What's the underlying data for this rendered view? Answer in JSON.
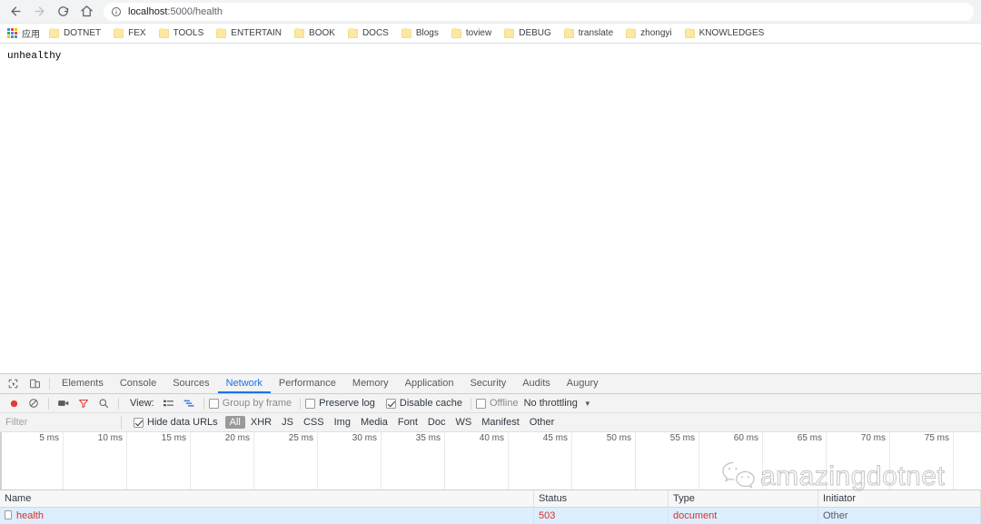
{
  "browser": {
    "nav": {
      "back_title": "Back",
      "forward_title": "Forward",
      "reload_title": "Reload",
      "home_title": "Home"
    },
    "omnibox": {
      "info_icon": "info-circle-icon",
      "url_host": "localhost",
      "url_rest": ":5000/health",
      "full_url": "localhost:5000/health"
    },
    "bookmarks": {
      "apps_label": "应用",
      "apps_icon": "apps-grid-icon",
      "items": [
        {
          "label": "DOTNET"
        },
        {
          "label": "FEX"
        },
        {
          "label": "TOOLS"
        },
        {
          "label": "ENTERTAIN"
        },
        {
          "label": "BOOK"
        },
        {
          "label": "DOCS"
        },
        {
          "label": "Blogs"
        },
        {
          "label": "toview"
        },
        {
          "label": "DEBUG"
        },
        {
          "label": "translate"
        },
        {
          "label": "zhongyi"
        },
        {
          "label": "KNOWLEDGES"
        }
      ]
    }
  },
  "page": {
    "body_text": "unhealthy"
  },
  "devtools": {
    "left_icons": [
      {
        "name": "inspect-element-icon"
      },
      {
        "name": "device-toolbar-icon"
      }
    ],
    "tabs": [
      {
        "label": "Elements",
        "active": false
      },
      {
        "label": "Console",
        "active": false
      },
      {
        "label": "Sources",
        "active": false
      },
      {
        "label": "Network",
        "active": true
      },
      {
        "label": "Performance",
        "active": false
      },
      {
        "label": "Memory",
        "active": false
      },
      {
        "label": "Application",
        "active": false
      },
      {
        "label": "Security",
        "active": false
      },
      {
        "label": "Audits",
        "active": false
      },
      {
        "label": "Augury",
        "active": false
      }
    ],
    "toolbar": {
      "record_icon": "record-circle-icon",
      "clear_icon": "clear-no-entry-icon",
      "capture_screenshots_icon": "camera-film-icon",
      "filter_icon": "funnel-filter-icon",
      "search_icon": "search-magnifier-icon",
      "view_label": "View:",
      "view_list_icon": "list-view-icon",
      "view_waterfall_icon": "waterfall-view-icon",
      "group_by_frame": {
        "label": "Group by frame",
        "checked": false,
        "disabled": true
      },
      "preserve_log": {
        "label": "Preserve log",
        "checked": false
      },
      "disable_cache": {
        "label": "Disable cache",
        "checked": true
      },
      "offline": {
        "label": "Offline",
        "checked": false
      },
      "throttling_value": "No throttling",
      "throttling_caret_icon": "chevron-down-icon"
    },
    "filterbar": {
      "filter_placeholder": "Filter",
      "filter_value": "",
      "hide_data_urls": {
        "label": "Hide data URLs",
        "checked": true
      },
      "types": [
        {
          "label": "All",
          "selected": true
        },
        {
          "label": "XHR",
          "selected": false
        },
        {
          "label": "JS",
          "selected": false
        },
        {
          "label": "CSS",
          "selected": false
        },
        {
          "label": "Img",
          "selected": false
        },
        {
          "label": "Media",
          "selected": false
        },
        {
          "label": "Font",
          "selected": false
        },
        {
          "label": "Doc",
          "selected": false
        },
        {
          "label": "WS",
          "selected": false
        },
        {
          "label": "Manifest",
          "selected": false
        },
        {
          "label": "Other",
          "selected": false
        }
      ]
    },
    "overview": {
      "ticks": [
        "5 ms",
        "10 ms",
        "15 ms",
        "20 ms",
        "25 ms",
        "30 ms",
        "35 ms",
        "40 ms",
        "45 ms",
        "50 ms",
        "55 ms",
        "60 ms",
        "65 ms",
        "70 ms",
        "75 ms"
      ]
    },
    "requests_table": {
      "columns": [
        "Name",
        "Status",
        "Type",
        "Initiator"
      ],
      "rows": [
        {
          "icon": "document-file-icon",
          "name": "health",
          "status": "503",
          "type": "document",
          "initiator": "Other",
          "selected": true
        }
      ]
    }
  },
  "watermark": {
    "icon": "wechat-logo-icon",
    "text": "amazingdotnet"
  },
  "colors": {
    "accent_blue": "#1a73e8",
    "error_red": "#d93025",
    "row_selected": "#ddeeff",
    "record_red": "#e53935",
    "bookmark_folder": "#fbe9a0"
  }
}
